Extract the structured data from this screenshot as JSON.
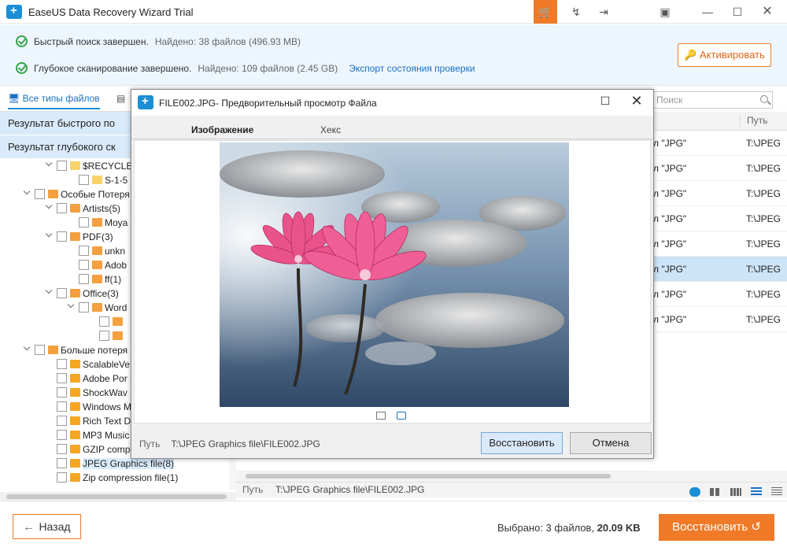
{
  "window": {
    "title": "EaseUS Data Recovery Wizard Trial"
  },
  "status": {
    "quick_label": "Быстрый поиск завершен.",
    "quick_count": "Найдено: 38 файлов (496.93 MB)",
    "deep_label": "Глубокое сканирование завершено.",
    "deep_count": "Найдено: 109 файлов (2.45 GB)",
    "export_link": "Экспорт состояния проверки",
    "activate_label": "Активировать"
  },
  "left": {
    "tab_all": "Все типы файлов",
    "group_quick": "Результат быстрого по",
    "group_deep": "Результат глубокого ск",
    "tree": [
      "$RECYCLE.",
      "S-1-5",
      "Особые Потеря",
      "Artists(5)",
      "Moya",
      "PDF(3)",
      "unkn",
      "Adob",
      "ff(1)",
      "Office(3)",
      "Word",
      "Больше потеря",
      "ScalableVe",
      "Adobe Por",
      "ShockWav",
      "Windows M",
      "Rich Text D",
      "MP3 Music",
      "GZIP comp",
      "JPEG Graphics file(8)",
      "Zip compression file(1)"
    ]
  },
  "right": {
    "search_placeholder": "Поиск",
    "col_path": "Путь",
    "rows": [
      {
        "type": "л \"JPG\"",
        "path": "T:\\JPEG"
      },
      {
        "type": "л \"JPG\"",
        "path": "T:\\JPEG"
      },
      {
        "type": "л \"JPG\"",
        "path": "T:\\JPEG"
      },
      {
        "type": "л \"JPG\"",
        "path": "T:\\JPEG"
      },
      {
        "type": "л \"JPG\"",
        "path": "T:\\JPEG"
      },
      {
        "type": "л \"JPG\"",
        "path": "T:\\JPEG"
      },
      {
        "type": "л \"JPG\"",
        "path": "T:\\JPEG"
      },
      {
        "type": "л \"JPG\"",
        "path": "T:\\JPEG"
      }
    ],
    "path_label": "Путь",
    "path_value": "T:\\JPEG Graphics file\\FILE002.JPG"
  },
  "footer": {
    "back_label": "Назад",
    "selected_prefix": "Выбрано: 3 файлов,",
    "selected_size": "20.09 KB",
    "recover_label": "Восстановить"
  },
  "modal": {
    "title": "FILE002.JPG- Предворительный просмотр Файла",
    "tab_image": "Изображение",
    "tab_hex": "Хекс",
    "path_label": "Путь",
    "path_value": "T:\\JPEG Graphics file\\FILE002.JPG",
    "recover_label": "Восстановить",
    "cancel_label": "Отмена"
  },
  "colors": {
    "accent": "#f07a28",
    "brand": "#1a8fd6",
    "selection": "#cce4f7"
  }
}
